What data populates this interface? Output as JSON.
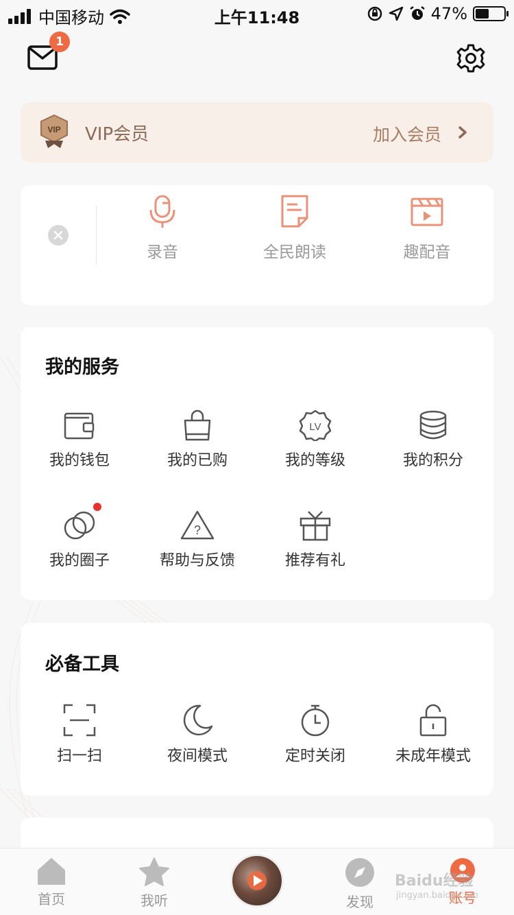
{
  "status_bar": {
    "carrier": "中国移动",
    "time": "上午11:48",
    "battery_percent": "47%",
    "battery_level": 0.47
  },
  "header": {
    "mail_badge_count": "1"
  },
  "vip": {
    "title": "VIP会员",
    "badge_text": "VIP",
    "join_label": "加入会员"
  },
  "create_items": [
    {
      "label": "录音",
      "icon": "microphone-icon"
    },
    {
      "label": "全民朗读",
      "icon": "document-icon"
    },
    {
      "label": "趣配音",
      "icon": "video-clapper-icon"
    }
  ],
  "my_services": {
    "title": "我的服务",
    "items": [
      {
        "label": "我的钱包",
        "icon": "wallet-icon"
      },
      {
        "label": "我的已购",
        "icon": "shopping-bag-icon"
      },
      {
        "label": "我的等级",
        "icon": "level-badge-icon",
        "badge_text": "LV"
      },
      {
        "label": "我的积分",
        "icon": "coin-stack-icon"
      },
      {
        "label": "我的圈子",
        "icon": "circles-icon",
        "has_red_dot": true
      },
      {
        "label": "帮助与反馈",
        "icon": "help-triangle-icon"
      },
      {
        "label": "推荐有礼",
        "icon": "gift-icon"
      }
    ]
  },
  "tools": {
    "title": "必备工具",
    "items": [
      {
        "label": "扫一扫",
        "icon": "scan-icon"
      },
      {
        "label": "夜间模式",
        "icon": "moon-icon"
      },
      {
        "label": "定时关闭",
        "icon": "timer-icon"
      },
      {
        "label": "未成年模式",
        "icon": "lock-icon"
      }
    ]
  },
  "tab_bar": {
    "items": [
      {
        "label": "首页",
        "icon": "home-icon"
      },
      {
        "label": "我听",
        "icon": "star-icon"
      },
      {
        "label": "发现",
        "icon": "compass-icon"
      },
      {
        "label": "账号",
        "icon": "account-icon",
        "active": true
      }
    ]
  },
  "colors": {
    "accent": "#ee6a43",
    "vip_bg": "#f8efe8",
    "vip_text": "#8c6a57",
    "create_icon": "#e8927a"
  },
  "watermark": {
    "brand": "Baidu经验",
    "url": "jingyan.baidu.com"
  }
}
